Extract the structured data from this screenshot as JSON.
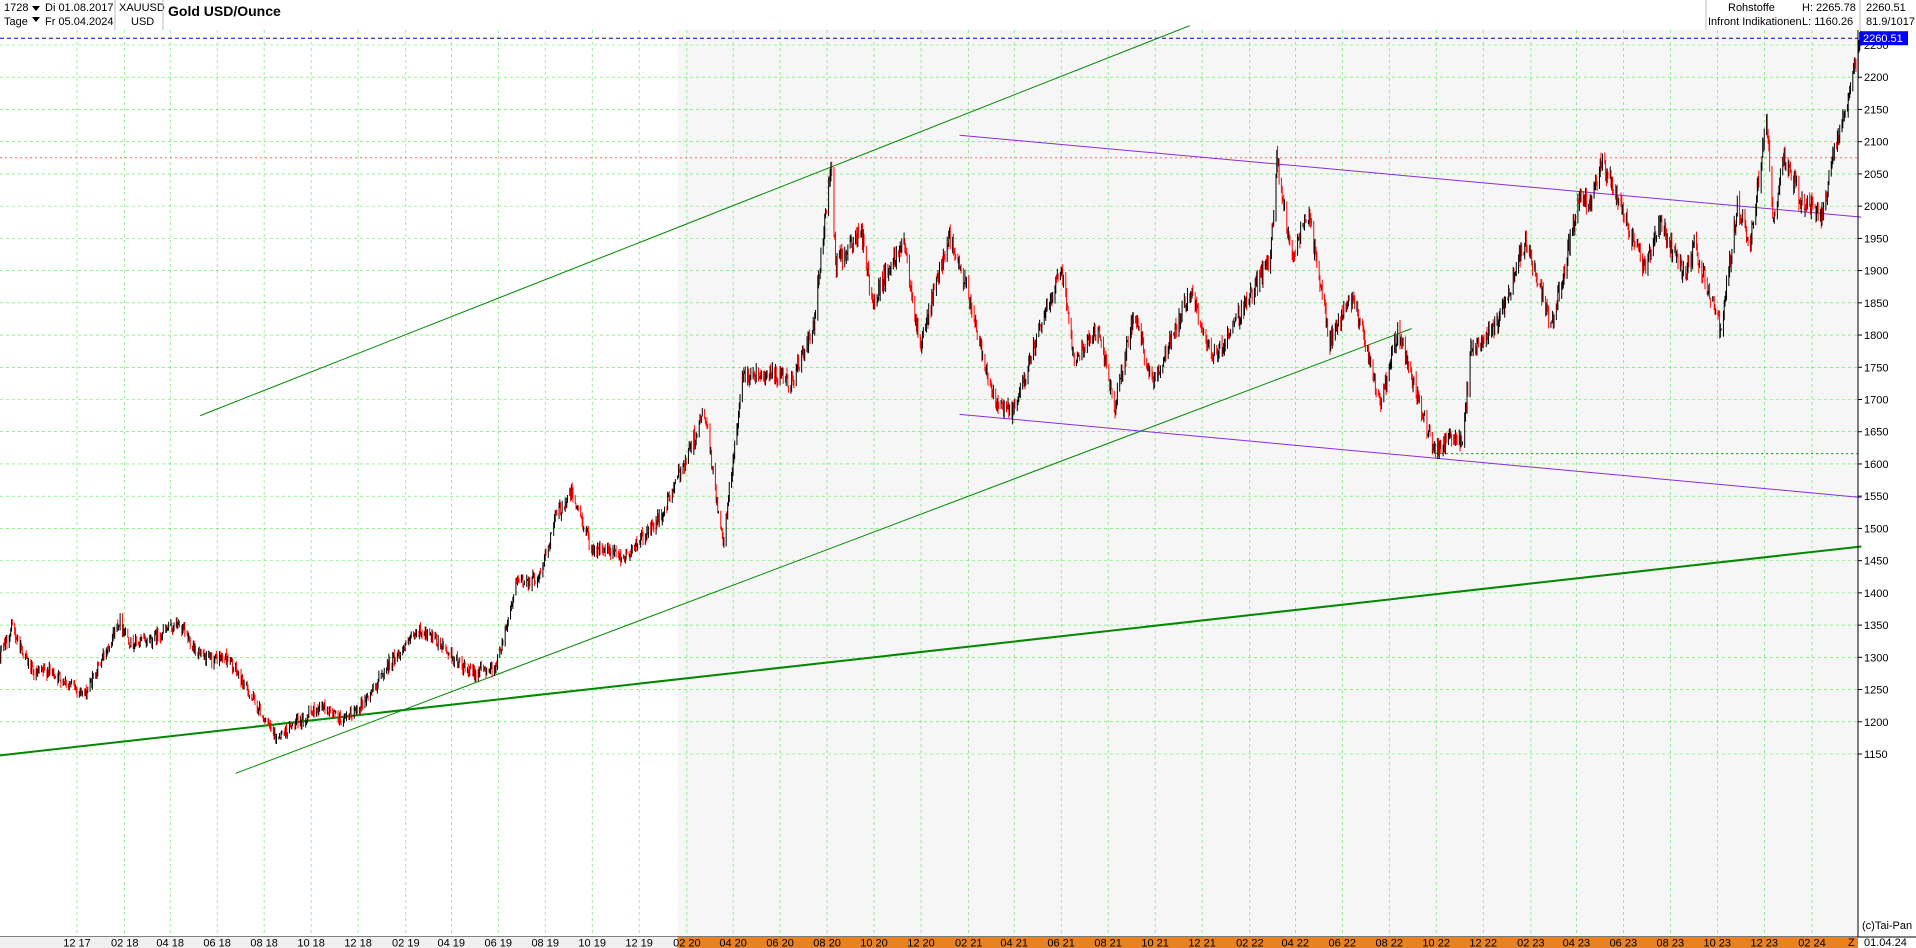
{
  "header": {
    "bars_count": "1728",
    "start_date": "Di 01.08.2017",
    "period": "Tage",
    "end_date": "Fr 05.04.2024",
    "symbol": "XAUUSD",
    "currency": "USD",
    "title": "Gold USD/Ounce",
    "category": "Rohstoffe",
    "source": "Infront Indikationen",
    "high_text": "H: 2265.78",
    "low_text": "L: 1160.26",
    "last_value": "2260.51",
    "range_text": "81.9/1017"
  },
  "footer": {
    "copyright": "(c)Tai-Pan",
    "z_marker": "Z",
    "last_date": "01.04.24"
  },
  "colors": {
    "candle_up": "#000000",
    "candle_down": "#ff0000",
    "grid": "#33dd33",
    "channel_green": "#008800",
    "channel_purple": "#8b2be2",
    "last_line": "#0000cc",
    "label_bg": "#0000ff",
    "ref_red": "#ff6666",
    "future_band": "#e8811e"
  },
  "chart_data": {
    "type": "candlestick",
    "title": "Gold USD/Ounce",
    "symbol": "XAUUSD",
    "period": "daily",
    "x_range": [
      "2017-08-01",
      "2024-04-05"
    ],
    "ylim": [
      1120,
      2280
    ],
    "y_ticks": [
      1150,
      1200,
      1250,
      1300,
      1350,
      1400,
      1450,
      1500,
      1550,
      1600,
      1650,
      1700,
      1750,
      1800,
      1850,
      1900,
      1950,
      2000,
      2050,
      2100,
      2150,
      2200,
      2250
    ],
    "x_tick_labels": [
      "12 17",
      "02 18",
      "04 18",
      "06 18",
      "08 18",
      "10 18",
      "12 18",
      "02 19",
      "04 19",
      "06 19",
      "08 19",
      "10 19",
      "12 19",
      "02 20",
      "04 20",
      "06 20",
      "08 20",
      "10 20",
      "12 20",
      "02 21",
      "04 21",
      "06 21",
      "08 21",
      "10 21",
      "12 21",
      "02 22",
      "04 22",
      "06 22",
      "08 22",
      "10 22",
      "12 22",
      "02 23",
      "04 23",
      "06 23",
      "08 23",
      "10 23",
      "12 23",
      "02 24"
    ],
    "x_tick_dates": [
      "2017-12-01",
      "2018-02-01",
      "2018-04-01",
      "2018-06-01",
      "2018-08-01",
      "2018-10-01",
      "2018-12-01",
      "2019-02-01",
      "2019-04-01",
      "2019-06-01",
      "2019-08-01",
      "2019-10-01",
      "2019-12-01",
      "2020-02-01",
      "2020-04-01",
      "2020-06-01",
      "2020-08-01",
      "2020-10-01",
      "2020-12-01",
      "2021-02-01",
      "2021-04-01",
      "2021-06-01",
      "2021-08-01",
      "2021-10-01",
      "2021-12-01",
      "2022-02-01",
      "2022-04-01",
      "2022-06-01",
      "2022-08-01",
      "2022-10-01",
      "2022-12-01",
      "2023-02-01",
      "2023-04-01",
      "2023-06-01",
      "2023-08-01",
      "2023-10-01",
      "2023-12-01",
      "2024-02-01"
    ],
    "future_band_start": "2020-01-20",
    "high": 2265.78,
    "low": 1160.26,
    "last": 2260.51,
    "last_date": "2024-04-05",
    "grid": true,
    "price_path": [
      [
        "2017-08-01",
        1265
      ],
      [
        "2017-08-20",
        1295
      ],
      [
        "2017-09-08",
        1345
      ],
      [
        "2017-10-06",
        1272
      ],
      [
        "2017-10-25",
        1280
      ],
      [
        "2017-12-12",
        1242
      ],
      [
        "2018-01-25",
        1357
      ],
      [
        "2018-02-10",
        1320
      ],
      [
        "2018-03-10",
        1330
      ],
      [
        "2018-04-11",
        1352
      ],
      [
        "2018-05-15",
        1295
      ],
      [
        "2018-06-14",
        1300
      ],
      [
        "2018-07-15",
        1240
      ],
      [
        "2018-08-16",
        1175
      ],
      [
        "2018-09-15",
        1200
      ],
      [
        "2018-10-15",
        1225
      ],
      [
        "2018-11-13",
        1200
      ],
      [
        "2018-12-15",
        1240
      ],
      [
        "2019-01-10",
        1290
      ],
      [
        "2019-02-20",
        1342
      ],
      [
        "2019-03-25",
        1312
      ],
      [
        "2019-04-23",
        1275
      ],
      [
        "2019-05-29",
        1285
      ],
      [
        "2019-06-25",
        1415
      ],
      [
        "2019-07-25",
        1425
      ],
      [
        "2019-08-15",
        1520
      ],
      [
        "2019-09-04",
        1555
      ],
      [
        "2019-10-01",
        1470
      ],
      [
        "2019-11-12",
        1455
      ],
      [
        "2019-12-31",
        1520
      ],
      [
        "2020-02-24",
        1680
      ],
      [
        "2020-03-19",
        1472
      ],
      [
        "2020-04-14",
        1740
      ],
      [
        "2020-05-15",
        1740
      ],
      [
        "2020-06-15",
        1725
      ],
      [
        "2020-07-15",
        1810
      ],
      [
        "2020-08-06",
        2070
      ],
      [
        "2020-08-12",
        1910
      ],
      [
        "2020-09-15",
        1960
      ],
      [
        "2020-09-28",
        1850
      ],
      [
        "2020-11-09",
        1950
      ],
      [
        "2020-11-30",
        1780
      ],
      [
        "2021-01-06",
        1955
      ],
      [
        "2021-02-01",
        1860
      ],
      [
        "2021-03-08",
        1690
      ],
      [
        "2021-03-31",
        1680
      ],
      [
        "2021-06-01",
        1910
      ],
      [
        "2021-06-18",
        1765
      ],
      [
        "2021-07-20",
        1810
      ],
      [
        "2021-08-09",
        1685
      ],
      [
        "2021-09-03",
        1830
      ],
      [
        "2021-09-29",
        1725
      ],
      [
        "2021-11-16",
        1870
      ],
      [
        "2021-12-15",
        1760
      ],
      [
        "2022-01-25",
        1845
      ],
      [
        "2022-02-28",
        1920
      ],
      [
        "2022-03-08",
        2070
      ],
      [
        "2022-03-28",
        1920
      ],
      [
        "2022-04-18",
        1990
      ],
      [
        "2022-05-16",
        1790
      ],
      [
        "2022-06-15",
        1860
      ],
      [
        "2022-07-21",
        1690
      ],
      [
        "2022-08-12",
        1805
      ],
      [
        "2022-09-28",
        1620
      ],
      [
        "2022-10-21",
        1640
      ],
      [
        "2022-11-04",
        1635
      ],
      [
        "2022-11-15",
        1775
      ],
      [
        "2022-12-20",
        1815
      ],
      [
        "2023-01-26",
        1950
      ],
      [
        "2023-02-28",
        1810
      ],
      [
        "2023-04-05",
        2020
      ],
      [
        "2023-04-20",
        2000
      ],
      [
        "2023-05-04",
        2070
      ],
      [
        "2023-06-29",
        1905
      ],
      [
        "2023-07-20",
        1975
      ],
      [
        "2023-08-21",
        1885
      ],
      [
        "2023-09-01",
        1940
      ],
      [
        "2023-10-06",
        1810
      ],
      [
        "2023-10-27",
        2000
      ],
      [
        "2023-11-13",
        1940
      ],
      [
        "2023-12-04",
        2140
      ],
      [
        "2023-12-13",
        1975
      ],
      [
        "2023-12-27",
        2080
      ],
      [
        "2024-01-18",
        2005
      ],
      [
        "2024-02-14",
        1985
      ],
      [
        "2024-03-01",
        2080
      ],
      [
        "2024-03-21",
        2180
      ],
      [
        "2024-04-05",
        2260.51
      ]
    ],
    "trendlines": [
      {
        "color": "channel_green",
        "points": [
          [
            "2018-05-10",
            1675
          ],
          [
            "2021-11-15",
            2280
          ]
        ]
      },
      {
        "color": "channel_green",
        "points": [
          [
            "2018-06-25",
            1120
          ],
          [
            "2022-08-30",
            1810
          ]
        ]
      },
      {
        "color": "channel_green",
        "points": [
          [
            "2017-08-01",
            1145
          ],
          [
            "2024-04-05",
            1472
          ]
        ],
        "width": 2
      },
      {
        "color": "channel_purple",
        "points": [
          [
            "2021-01-20",
            2110
          ],
          [
            "2024-04-05",
            1983
          ]
        ]
      },
      {
        "color": "channel_purple",
        "points": [
          [
            "2021-01-20",
            1677
          ],
          [
            "2024-04-05",
            1548
          ]
        ]
      }
    ],
    "reference_lines": [
      {
        "value": 2075,
        "color": "ref_red",
        "style": "dotted"
      },
      {
        "value": 2260.51,
        "color": "last_line",
        "style": "dashed"
      },
      {
        "value": 1616,
        "color": "channel_green",
        "style": "dotted",
        "from": "2022-10-01"
      }
    ]
  }
}
